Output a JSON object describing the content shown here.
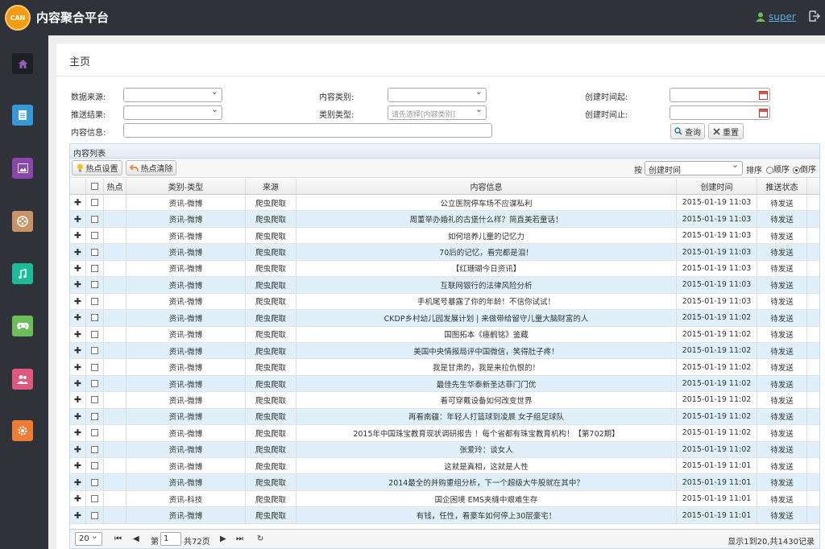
{
  "app": {
    "logo_text": "CAN",
    "title": "内容聚合平台",
    "user": "super"
  },
  "sidebar": {
    "items": [
      {
        "icon": "home-icon",
        "color": "#9b59b6"
      },
      {
        "icon": "document-icon",
        "color": "#3498db"
      },
      {
        "icon": "image-icon",
        "color": "#8e44ad"
      },
      {
        "icon": "film-icon",
        "color": "#c8956a"
      },
      {
        "icon": "music-icon",
        "color": "#1abc9c"
      },
      {
        "icon": "gamepad-icon",
        "color": "#6bbf59"
      },
      {
        "icon": "users-icon",
        "color": "#e0587e"
      },
      {
        "icon": "gear-icon",
        "color": "#f07b35"
      }
    ]
  },
  "page": {
    "title": "主页"
  },
  "filters": {
    "source_label": "数据来源:",
    "content_type_label": "内容类别:",
    "created_from_label": "创建时间起:",
    "push_result_label": "推送结果:",
    "category_type_label": "类别类型:",
    "category_type_placeholder": "请先选择[内容类别]",
    "created_to_label": "创建时间止:",
    "content_info_label": "内容信息:",
    "search_button": "查询",
    "reset_button": "重置"
  },
  "grid": {
    "caption": "内容列表",
    "hot_set_button": "热点设置",
    "hot_clear_button": "热点清除",
    "sort_by_label": "按",
    "sort_field": "创建时间",
    "sort_label": "排序",
    "asc_label": "顺序",
    "desc_label": "倒序",
    "columns": [
      "热点",
      "类别-类型",
      "来源",
      "内容信息",
      "创建时间",
      "推送状态"
    ],
    "rows": [
      {
        "category": "资讯-微博",
        "source": "爬虫爬取",
        "info": "公立医院停车场不应谋私利",
        "time": "2015-01-19 11:03",
        "status": "待发送"
      },
      {
        "category": "资讯-微博",
        "source": "爬虫爬取",
        "info": "周董举办婚礼的古堡什么样？简直美若童话！",
        "time": "2015-01-19 11:03",
        "status": "待发送"
      },
      {
        "category": "资讯-微博",
        "source": "爬虫爬取",
        "info": "如何培养儿童的记忆力",
        "time": "2015-01-19 11:03",
        "status": "待发送"
      },
      {
        "category": "资讯-微博",
        "source": "爬虫爬取",
        "info": "70后的记忆，看完都是泪！",
        "time": "2015-01-19 11:03",
        "status": "待发送"
      },
      {
        "category": "资讯-微博",
        "source": "爬虫爬取",
        "info": "【红珊瑚今日资讯】",
        "time": "2015-01-19 11:03",
        "status": "待发送"
      },
      {
        "category": "资讯-微博",
        "source": "爬虫爬取",
        "info": "互联网银行的法律风险分析",
        "time": "2015-01-19 11:03",
        "status": "待发送"
      },
      {
        "category": "资讯-微博",
        "source": "爬虫爬取",
        "info": "手机尾号暴露了你的年龄！不信你试试！",
        "time": "2015-01-19 11:03",
        "status": "待发送"
      },
      {
        "category": "资讯-微博",
        "source": "爬虫爬取",
        "info": "CKDP乡村幼儿园发展计划 | 来做带给留守儿童大脑财富的人",
        "time": "2015-01-19 11:02",
        "status": "待发送"
      },
      {
        "category": "资讯-微博",
        "source": "爬虫爬取",
        "info": "国图拓本《瘗鹤铭》鉴藏",
        "time": "2015-01-19 11:02",
        "status": "待发送"
      },
      {
        "category": "资讯-微博",
        "source": "爬虫爬取",
        "info": "美国中央情报局评中国微信，笑得肚子疼！",
        "time": "2015-01-19 11:02",
        "status": "待发送"
      },
      {
        "category": "资讯-微博",
        "source": "爬虫爬取",
        "info": "我是甘肃的，我是来拉仇恨的！",
        "time": "2015-01-19 11:02",
        "status": "待发送"
      },
      {
        "category": "资讯-微博",
        "source": "爬虫爬取",
        "info": "最佳先生华泰新圣达菲门门优",
        "time": "2015-01-19 11:02",
        "status": "待发送"
      },
      {
        "category": "资讯-微博",
        "source": "爬虫爬取",
        "info": "看可穿戴设备如何改变世界",
        "time": "2015-01-19 11:02",
        "status": "待发送"
      },
      {
        "category": "资讯-微博",
        "source": "爬虫爬取",
        "info": "再看南疆：年轻人打篮球到凌晨 女子组足球队",
        "time": "2015-01-19 11:02",
        "status": "待发送"
      },
      {
        "category": "资讯-微博",
        "source": "爬虫爬取",
        "info": "2015年中国珠宝教育现状调研报告 ！每个省都有珠宝教育机构！【第702期】",
        "time": "2015-01-19 11:02",
        "status": "待发送"
      },
      {
        "category": "资讯-微博",
        "source": "爬虫爬取",
        "info": "张爱玲：谈女人",
        "time": "2015-01-19 11:02",
        "status": "待发送"
      },
      {
        "category": "资讯-微博",
        "source": "爬虫爬取",
        "info": "这就是真相，这就是人性",
        "time": "2015-01-19 11:01",
        "status": "待发送"
      },
      {
        "category": "资讯-微博",
        "source": "爬虫爬取",
        "info": "2014最全的并购重组分析，下一个超级大牛股就在其中？",
        "time": "2015-01-19 11:01",
        "status": "待发送"
      },
      {
        "category": "资讯-科技",
        "source": "爬虫爬取",
        "info": "国企困境 EMS夹缝中艰难生存",
        "time": "2015-01-19 11:01",
        "status": "待发送"
      },
      {
        "category": "资讯-微博",
        "source": "爬虫爬取",
        "info": "有钱，任性，看豪车如何停上30层豪宅！",
        "time": "2015-01-19 11:01",
        "status": "待发送"
      }
    ]
  },
  "pager": {
    "page_size": "20",
    "page_label": "第",
    "page_value": "1",
    "total_pages": "共72页",
    "summary": "显示1到20,共1430记录"
  }
}
